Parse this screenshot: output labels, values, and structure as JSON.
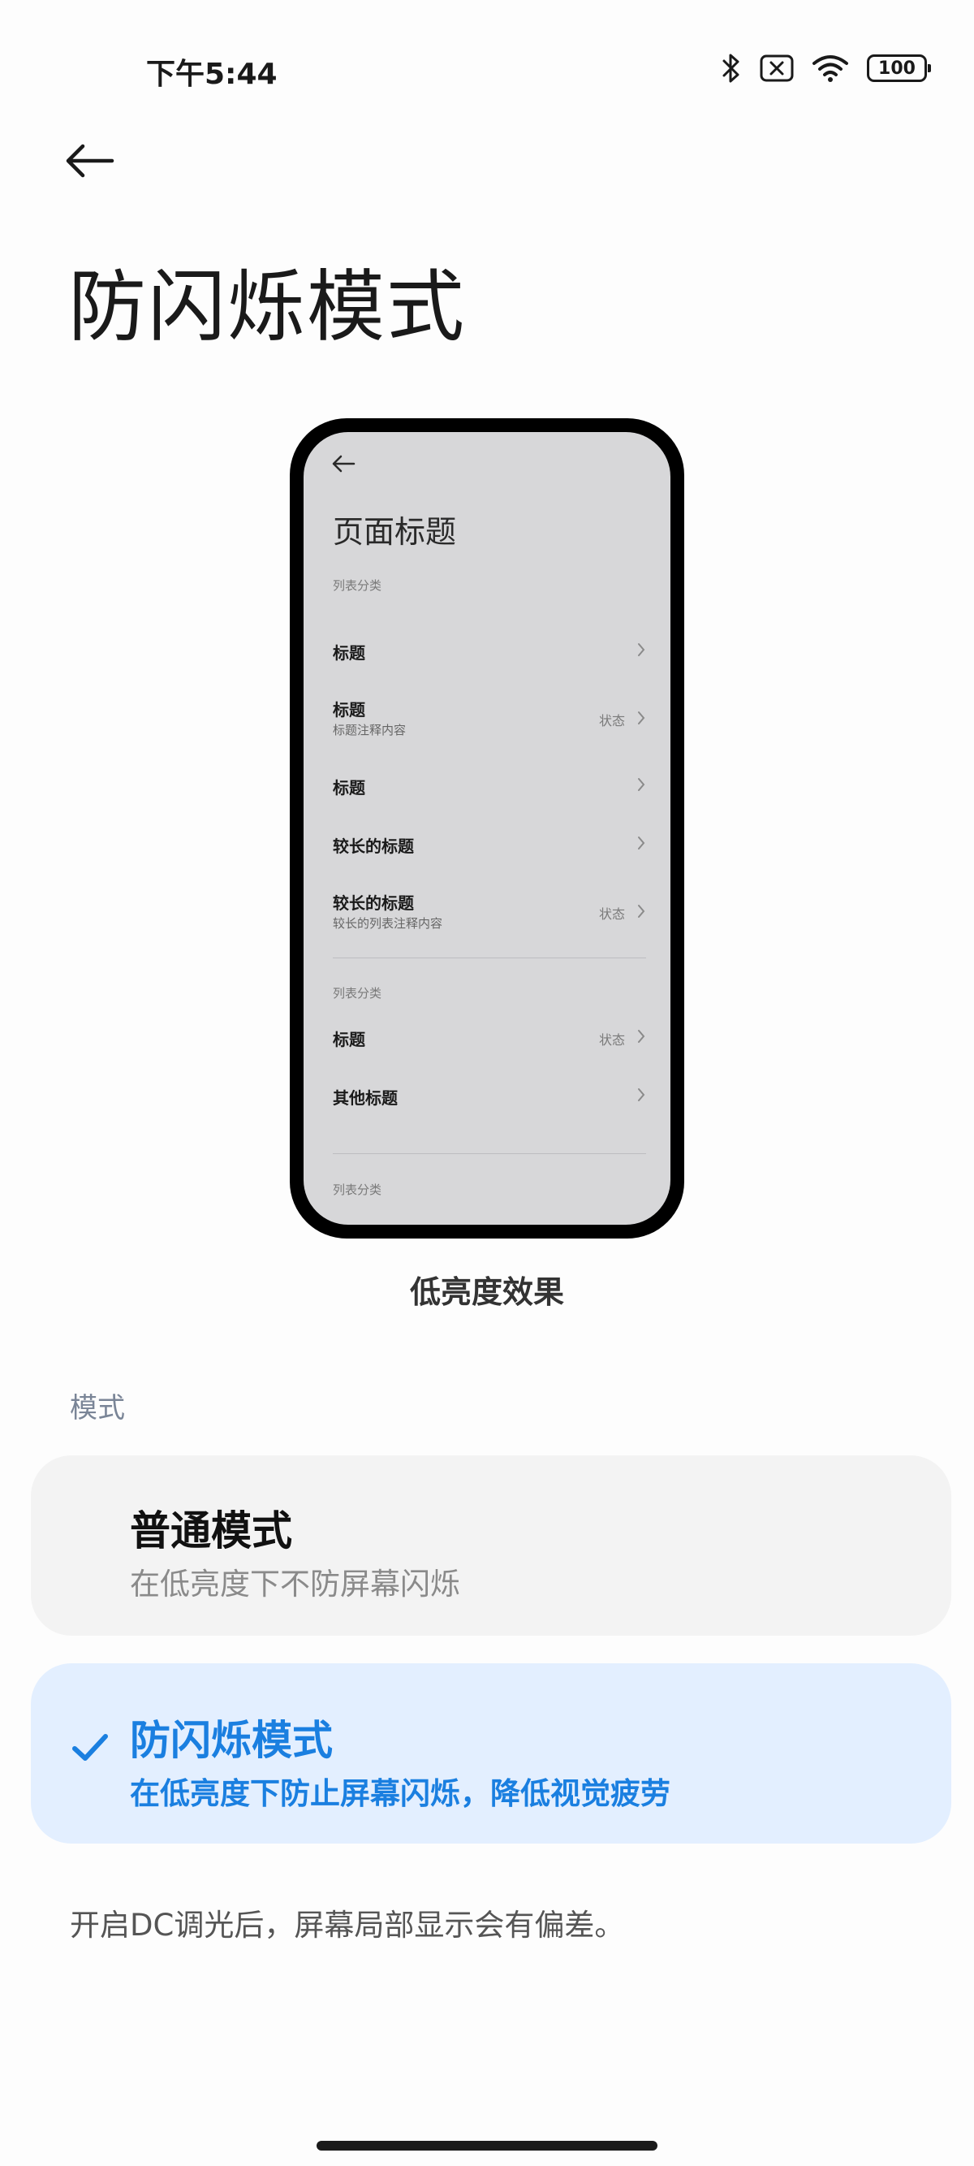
{
  "status_bar": {
    "time": "下午5:44",
    "battery": "100",
    "icons": [
      "bluetooth-icon",
      "no-sim-icon",
      "wifi-icon",
      "battery-icon"
    ]
  },
  "header": {
    "title": "防闪烁模式",
    "back_icon": "arrow-left-icon"
  },
  "preview": {
    "caption": "低亮度效果",
    "screen": {
      "title": "页面标题",
      "sections": [
        {
          "label": "列表分类",
          "rows": [
            {
              "title": "标题",
              "subtitle": "",
              "status": ""
            },
            {
              "title": "标题",
              "subtitle": "标题注释内容",
              "status": "状态"
            },
            {
              "title": "标题",
              "subtitle": "",
              "status": ""
            },
            {
              "title": "较长的标题",
              "subtitle": "",
              "status": ""
            },
            {
              "title": "较长的标题",
              "subtitle": "较长的列表注释内容",
              "status": "状态"
            }
          ]
        },
        {
          "label": "列表分类",
          "rows": [
            {
              "title": "标题",
              "subtitle": "",
              "status": "状态"
            },
            {
              "title": "其他标题",
              "subtitle": "",
              "status": ""
            }
          ]
        },
        {
          "label": "列表分类",
          "rows": []
        }
      ]
    }
  },
  "mode": {
    "section_label": "模式",
    "options": [
      {
        "title": "普通模式",
        "subtitle": "在低亮度下不防屏幕闪烁",
        "selected": false
      },
      {
        "title": "防闪烁模式",
        "subtitle": "在低亮度下防止屏幕闪烁，降低视觉疲劳",
        "selected": true
      }
    ]
  },
  "footer_note": "开启DC调光后，屏幕局部显示会有偏差。",
  "colors": {
    "accent": "#1a7fe0",
    "selected_card_bg": "#e3efff",
    "card_bg": "#f3f3f3",
    "preview_screen_bg": "#d7d7d9"
  }
}
